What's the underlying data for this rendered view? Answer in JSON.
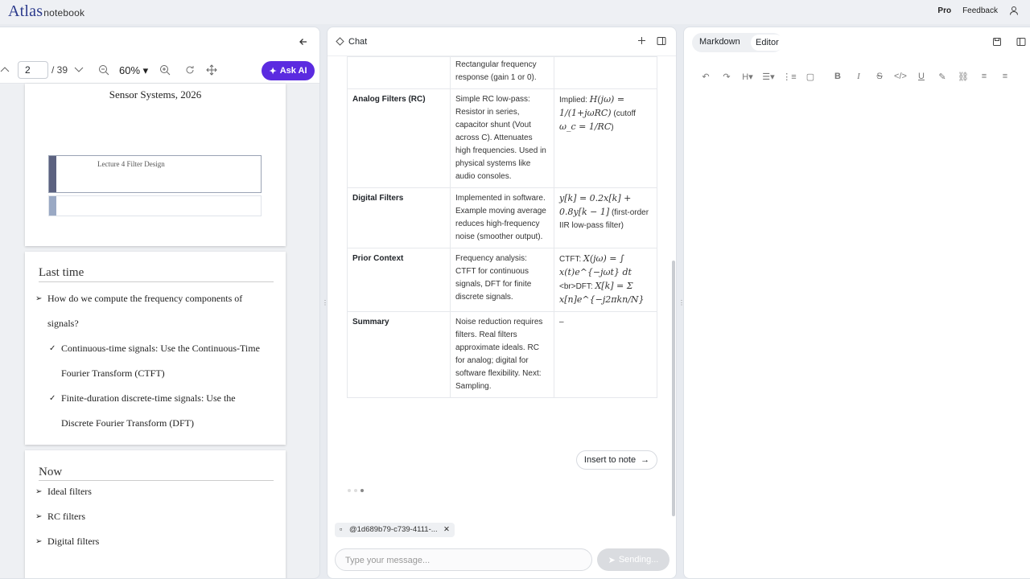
{
  "app": {
    "brand": "Atlas",
    "brand_suffix": "notebook",
    "pro": "Pro",
    "feedback": "Feedback"
  },
  "pdf": {
    "page": "2",
    "total": "/ 39",
    "zoom": "60%",
    "ask_ai": "Ask AI",
    "slide1": {
      "title": "Sensor Systems, 2026",
      "box_label": "Lecture 4 Filter Design"
    },
    "slide2": {
      "heading": "Last time",
      "bullets": [
        "How do we compute the frequency components of",
        "signals?",
        "Continuous-time signals: Use the Continuous-Time",
        "Fourier Transform (CTFT)",
        "Finite-duration discrete-time signals: Use the",
        "Discrete Fourier Transform (DFT)"
      ]
    },
    "slide3": {
      "heading": "Now",
      "bullets": [
        "Ideal filters",
        "RC filters",
        "Digital filters"
      ]
    }
  },
  "chat": {
    "title": "Chat",
    "rows": [
      {
        "topic": "",
        "desc": "Rectangular frequency response (gain 1 or 0).",
        "eq": ""
      },
      {
        "topic": "Analog Filters (RC)",
        "desc": "Simple RC low-pass: Resistor in series, capacitor shunt (Vout across C). Attenuates high frequencies. Used in physical systems like audio consoles.",
        "eq_a": "Implied: ",
        "eq_b": "H(jω) = 1/(1+jωRC)",
        "eq_c": " (cutoff ",
        "eq_d": "ω_c = 1/RC",
        "eq_e": ")"
      },
      {
        "topic": "Digital Filters",
        "desc": "Implemented in software. Example moving average reduces high-frequency noise (smoother output).",
        "eq_b": "y[k] = 0.2x[k] + 0.8y[k − 1]",
        "eq_c": " (first-order IIR low-pass filter)"
      },
      {
        "topic": "Prior Context",
        "desc": "Frequency analysis: CTFT for continuous signals, DFT for finite discrete signals.",
        "eq_a": "CTFT: ",
        "eq_b": "X(jω) = ∫ x(t)e^{−jωt} dt",
        "eq_c": " <br>DFT: ",
        "eq_d": "X[k] = Σ x[n]e^{−j2πkn/N}"
      },
      {
        "topic": "Summary",
        "desc": "Noise reduction requires filters. Real filters approximate ideals. RC for analog; digital for software flexibility. Next: Sampling.",
        "eq": "–"
      }
    ],
    "insert": "Insert to note",
    "attachment": "@1d689b79-c739-4111-...",
    "placeholder": "Type your message...",
    "send": "Sending..."
  },
  "editor": {
    "tab_markdown": "Markdown",
    "tab_editor": "Editor"
  }
}
